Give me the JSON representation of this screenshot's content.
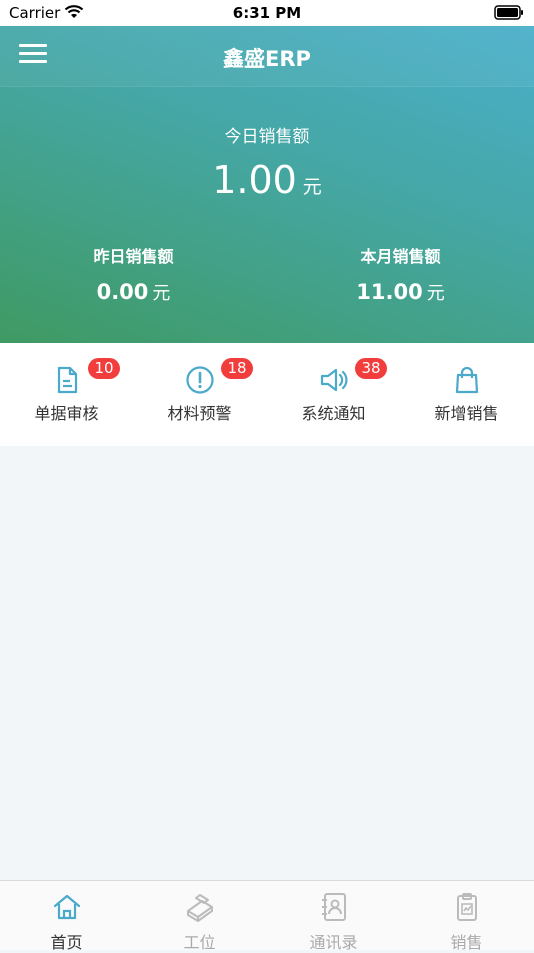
{
  "status_bar": {
    "carrier": "Carrier",
    "time": "6:31 PM"
  },
  "header": {
    "title": "鑫盛ERP",
    "menu_icon": "hamburger-menu-icon"
  },
  "summary": {
    "today": {
      "label": "今日销售额",
      "value": "1.00",
      "unit": "元"
    },
    "yesterday": {
      "label": "昨日销售额",
      "value": "0.00",
      "unit": "元"
    },
    "month": {
      "label": "本月销售额",
      "value": "11.00",
      "unit": "元"
    }
  },
  "quick_actions": [
    {
      "label": "单据审核",
      "badge": "10",
      "icon": "document-icon"
    },
    {
      "label": "材料预警",
      "badge": "18",
      "icon": "alert-circle-icon"
    },
    {
      "label": "系统通知",
      "badge": "38",
      "icon": "megaphone-icon"
    },
    {
      "label": "新增销售",
      "badge": "",
      "icon": "shopping-bag-icon"
    }
  ],
  "tabs": [
    {
      "label": "首页",
      "icon": "home-icon",
      "active": true
    },
    {
      "label": "工位",
      "icon": "workstation-icon",
      "active": false
    },
    {
      "label": "通讯录",
      "icon": "contacts-icon",
      "active": false
    },
    {
      "label": "销售",
      "icon": "sales-clipboard-icon",
      "active": false
    }
  ],
  "colors": {
    "accent": "#4ba9c9",
    "badge": "#f23d3d",
    "gradient_start": "#3f9a63",
    "gradient_end": "#4bb0cf"
  }
}
